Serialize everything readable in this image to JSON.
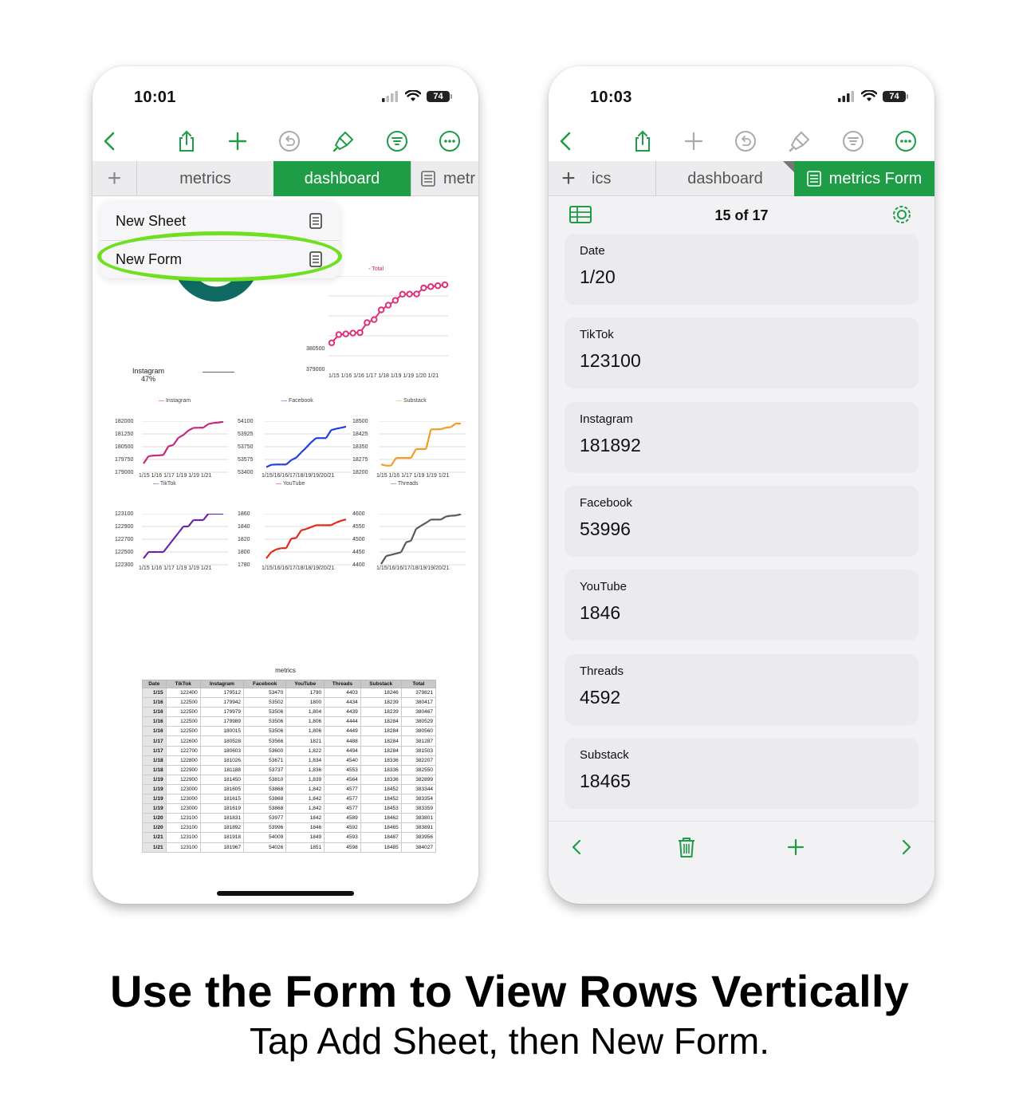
{
  "colors": {
    "accent": "#1f9c46",
    "highlight": "#6fe01f"
  },
  "left_phone": {
    "time": "10:01",
    "battery": "74",
    "toolbar": [
      "back-icon",
      "share-icon",
      "add-icon",
      "undo-icon",
      "format-brush-icon",
      "organize-icon",
      "more-icon"
    ],
    "tabs": {
      "plus": "+",
      "t1": "metrics",
      "t2": "dashboard",
      "t3": "metr"
    },
    "menu": {
      "new_sheet": "New Sheet",
      "new_form": "New Form"
    },
    "donut": {
      "label": "Instagram",
      "pct": "47%"
    },
    "total_chart": {
      "legend": "Total",
      "y_ticks": [
        "380500",
        "379000"
      ],
      "x_ticks": "1/15 1/16 1/16 1/17 1/18 1/19 1/19 1/20 1/21"
    },
    "charts": [
      {
        "legend": "Instagram",
        "series_label_below": "TikTok",
        "y_ticks": [
          "182000",
          "181250",
          "180500",
          "179750",
          "179000"
        ],
        "x_ticks": "1/15 1/16 1/17 1/19 1/19 1/21",
        "color": "#c4297a"
      },
      {
        "legend": "Facebook",
        "series_label_below": "YouTube",
        "y_ticks": [
          "54100",
          "53925",
          "53750",
          "53575",
          "53400"
        ],
        "x_ticks": "1/15/16/16/17/18/19/19/20/21",
        "color": "#1f3ee0"
      },
      {
        "legend": "Substack",
        "series_label_below": "Threads",
        "y_ticks": [
          "18500",
          "18425",
          "18350",
          "18275",
          "18200"
        ],
        "x_ticks": "1/15 1/16 1/17 1/19 1/19 1/21",
        "color": "#f39c1e"
      },
      {
        "legend": "",
        "series_label_below": "",
        "y_ticks": [
          "123100",
          "122900",
          "122700",
          "122500",
          "122300"
        ],
        "x_ticks": "1/15 1/16 1/17 1/19 1/19 1/21",
        "color": "#6a22a8"
      },
      {
        "legend": "",
        "series_label_below": "",
        "y_ticks": [
          "1860",
          "1840",
          "1820",
          "1800",
          "1780"
        ],
        "x_ticks": "1/15/16/16/17/18/18/19/20/21",
        "color": "#e02a18"
      },
      {
        "legend": "",
        "series_label_below": "",
        "y_ticks": [
          "4600",
          "4550",
          "4500",
          "4450",
          "4400"
        ],
        "x_ticks": "1/15/16/16/17/18/19/19/20/21",
        "color": "#555a60"
      }
    ],
    "table": {
      "title": "metrics",
      "headers": [
        "Date",
        "TikTok",
        "Instagram",
        "Facebook",
        "YouTube",
        "Threads",
        "Substack",
        "Total"
      ],
      "rows": [
        [
          "1/15",
          "122400",
          "179512",
          "53470",
          "1790",
          "4403",
          "18246",
          "379821"
        ],
        [
          "1/16",
          "122500",
          "179942",
          "53502",
          "1800",
          "4434",
          "18239",
          "380417"
        ],
        [
          "1/16",
          "122500",
          "179979",
          "53506",
          "1,804",
          "4439",
          "18239",
          "380467"
        ],
        [
          "1/16",
          "122500",
          "179989",
          "53506",
          "1,806",
          "4444",
          "18284",
          "380529"
        ],
        [
          "1/16",
          "122500",
          "180015",
          "53506",
          "1,806",
          "4449",
          "18284",
          "380560"
        ],
        [
          "1/17",
          "122600",
          "180528",
          "53566",
          "1821",
          "4488",
          "18284",
          "381287"
        ],
        [
          "1/17",
          "122700",
          "180603",
          "53600",
          "1,822",
          "4494",
          "18284",
          "381503"
        ],
        [
          "1/18",
          "122800",
          "181026",
          "53671",
          "1,834",
          "4540",
          "18336",
          "382207"
        ],
        [
          "1/18",
          "122900",
          "181188",
          "53737",
          "1,836",
          "4553",
          "18336",
          "382550"
        ],
        [
          "1/19",
          "122900",
          "181450",
          "53810",
          "1,839",
          "4564",
          "18336",
          "382899"
        ],
        [
          "1/19",
          "123000",
          "181605",
          "53868",
          "1,842",
          "4577",
          "18452",
          "383344"
        ],
        [
          "1/19",
          "123000",
          "181615",
          "53868",
          "1,842",
          "4577",
          "18452",
          "383354"
        ],
        [
          "1/19",
          "123000",
          "181619",
          "53868",
          "1,842",
          "4577",
          "18453",
          "383359"
        ],
        [
          "1/20",
          "123100",
          "181831",
          "53977",
          "1842",
          "4589",
          "18462",
          "383801"
        ],
        [
          "1/20",
          "123100",
          "181892",
          "53996",
          "1846",
          "4592",
          "18465",
          "383891"
        ],
        [
          "1/21",
          "123100",
          "181918",
          "54009",
          "1849",
          "4593",
          "18487",
          "383956"
        ],
        [
          "1/21",
          "123100",
          "181967",
          "54026",
          "1851",
          "4598",
          "18485",
          "384027"
        ]
      ]
    }
  },
  "right_phone": {
    "time": "10:03",
    "battery": "74",
    "tabs": {
      "plus": "+",
      "t1": "ics",
      "t2": "dashboard",
      "t3": "metrics Form"
    },
    "counter": "15 of 17",
    "fields": [
      {
        "label": "Date",
        "value": "1/20"
      },
      {
        "label": "TikTok",
        "value": "123100"
      },
      {
        "label": "Instagram",
        "value": "181892"
      },
      {
        "label": "Facebook",
        "value": "53996"
      },
      {
        "label": "YouTube",
        "value": "1846"
      },
      {
        "label": "Threads",
        "value": "4592"
      },
      {
        "label": "Substack",
        "value": "18465"
      }
    ],
    "footer": [
      "previous-icon",
      "trash-icon",
      "add-icon",
      "next-icon"
    ]
  },
  "caption": {
    "title": "Use the Form to View Rows Vertically",
    "subtitle": "Tap Add Sheet, then New Form."
  }
}
